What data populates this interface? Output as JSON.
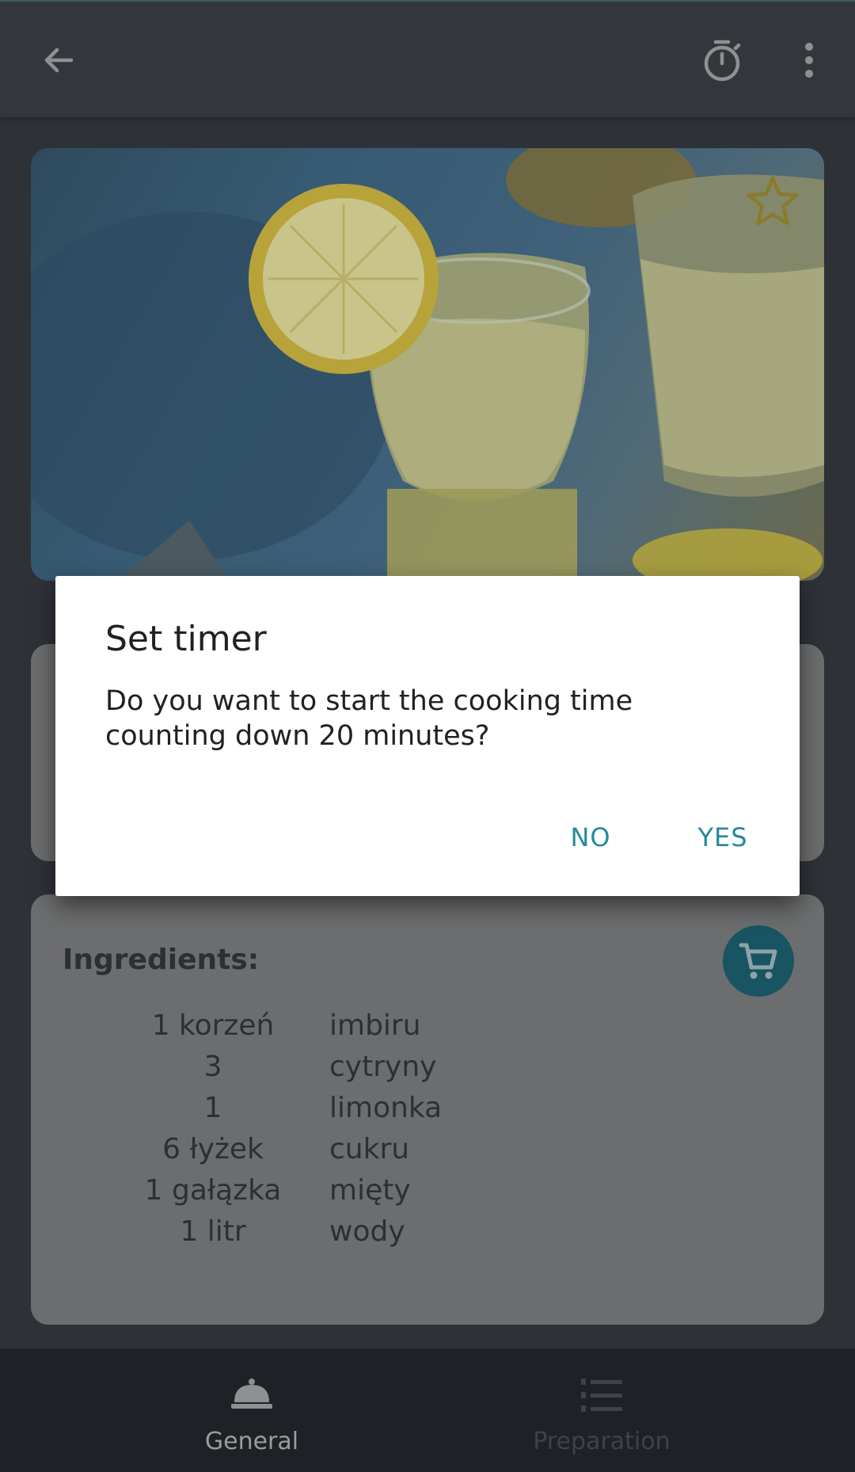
{
  "appbar": {
    "back_icon": "arrow-back-icon",
    "timer_icon": "stopwatch-icon",
    "more_icon": "more-vert-icon"
  },
  "hero": {
    "favorite_icon": "star-outline-icon",
    "favorite_color": "#8a7a2a"
  },
  "ingredients": {
    "title": "Ingredients:",
    "cart_icon": "shopping-cart-icon",
    "items": [
      {
        "qty": "1 korzeń",
        "name": "imbiru"
      },
      {
        "qty": "3",
        "name": "cytryny"
      },
      {
        "qty": "1",
        "name": "limonka"
      },
      {
        "qty": "6 łyżek",
        "name": "cukru"
      },
      {
        "qty": "1 gałązka",
        "name": "mięty"
      },
      {
        "qty": "1 litr",
        "name": "wody"
      }
    ]
  },
  "bottom_nav": {
    "general_label": "General",
    "general_icon": "room-service-bell-icon",
    "preparation_label": "Preparation",
    "preparation_icon": "numbered-list-icon"
  },
  "dialog": {
    "title": "Set timer",
    "message": "Do you want to start the cooking time counting down 20 minutes?",
    "no_label": "NO",
    "yes_label": "YES",
    "accent_color": "#26899a"
  }
}
